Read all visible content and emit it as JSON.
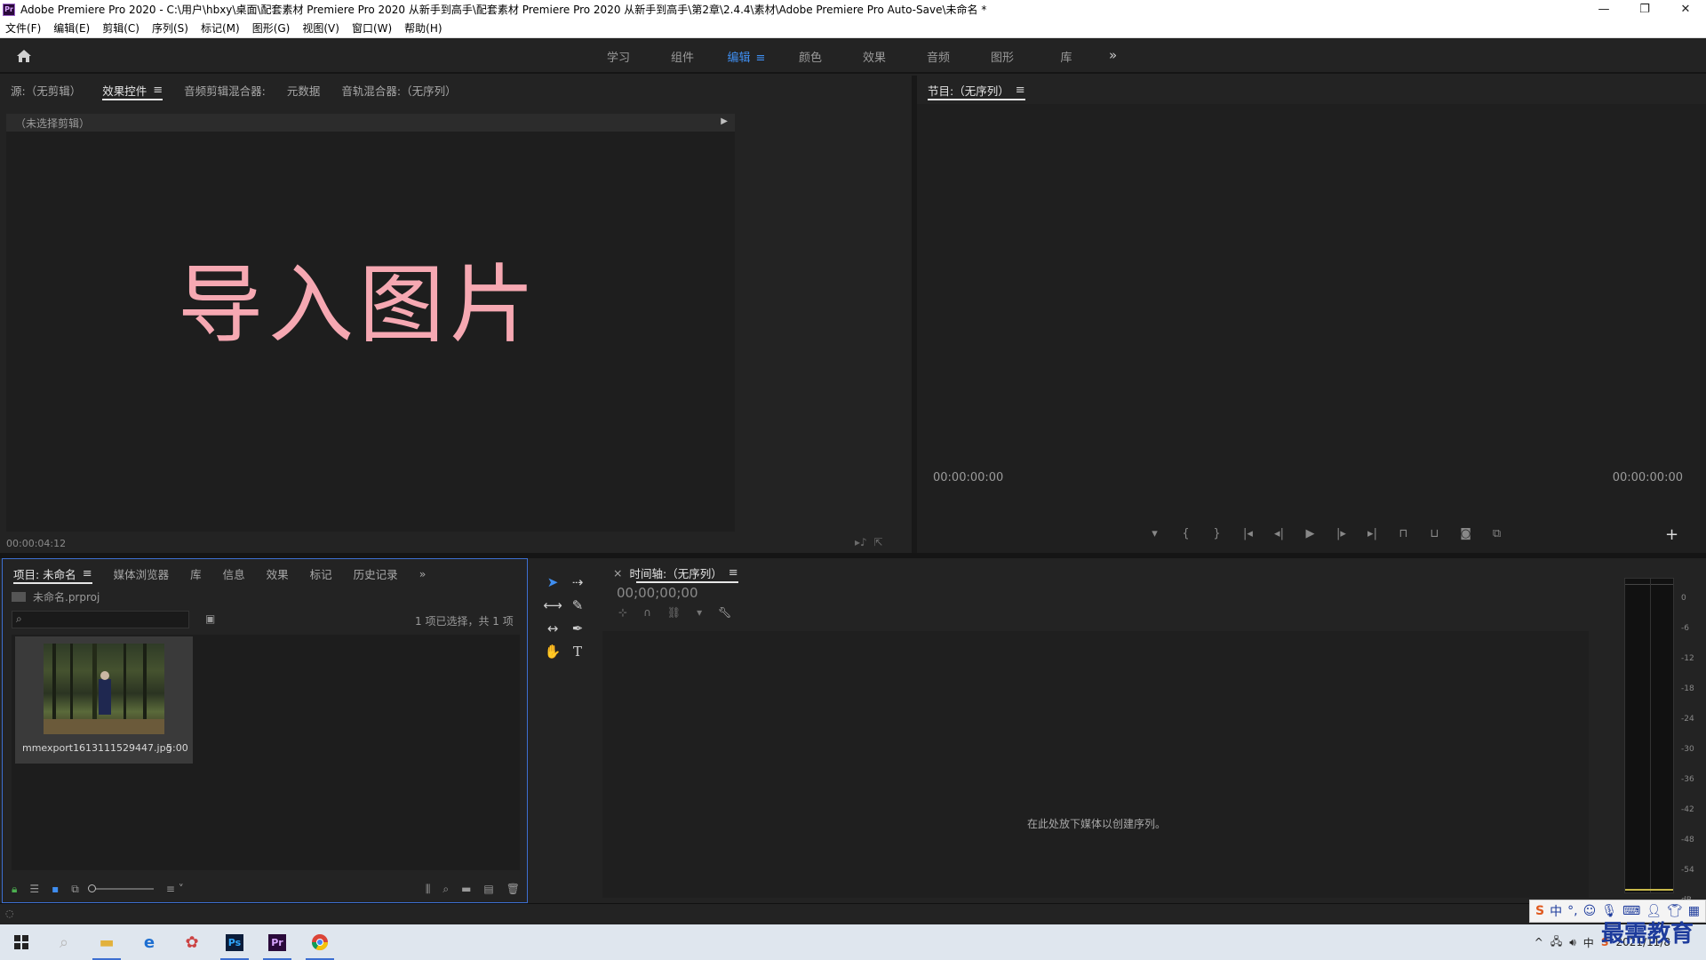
{
  "window": {
    "title": "Adobe Premiere Pro 2020 - C:\\用户\\hbxy\\桌面\\配套素材 Premiere Pro 2020 从新手到高手\\配套素材 Premiere Pro 2020 从新手到高手\\第2章\\2.4.4\\素材\\Adobe Premiere Pro Auto-Save\\未命名 *",
    "app_icon": "Pr"
  },
  "menu": [
    "文件(F)",
    "编辑(E)",
    "剪辑(C)",
    "序列(S)",
    "标记(M)",
    "图形(G)",
    "视图(V)",
    "窗口(W)",
    "帮助(H)"
  ],
  "workspaces": {
    "items": [
      "学习",
      "组件",
      "编辑",
      "颜色",
      "效果",
      "音频",
      "图形",
      "库"
    ],
    "active": "编辑",
    "more": "»"
  },
  "source_panel": {
    "tabs": [
      "源:（无剪辑）",
      "效果控件",
      "音频剪辑混合器:",
      "元数据",
      "音轨混合器:（无序列）"
    ],
    "active_tab": "效果控件",
    "header_text": "（未选择剪辑）",
    "overlay_text": "导入图片",
    "timecode": "00:00:04:12"
  },
  "program_panel": {
    "title": "节目:（无序列）",
    "timecode_left": "00:00:00:00",
    "timecode_right": "00:00:00:00"
  },
  "project_panel": {
    "tabs": [
      "项目: 未命名",
      "媒体浏览器",
      "库",
      "信息",
      "效果",
      "标记",
      "历史记录"
    ],
    "active_tab": "项目: 未命名",
    "file_name": "未命名.prproj",
    "selection_count": "1 项已选择，共 1 项",
    "item": {
      "name": "mmexport1613111529447.jpg",
      "duration": "5:00"
    }
  },
  "timeline_panel": {
    "title": "时间轴:（无序列）",
    "timecode": "00;00;00;00",
    "drop_hint": "在此处放下媒体以创建序列。"
  },
  "audio_meter": {
    "scale": [
      "0",
      "-6",
      "-12",
      "-18",
      "-24",
      "-30",
      "-36",
      "-42",
      "-48",
      "-54",
      "dB"
    ]
  },
  "taskbar": {
    "date": "2021/11/8",
    "watermark": "最需教育",
    "ime": "中"
  },
  "colors": {
    "accent_blue": "#3f8ef0",
    "overlay_pink": "#f6a8b2",
    "panel_bg": "#232323"
  }
}
